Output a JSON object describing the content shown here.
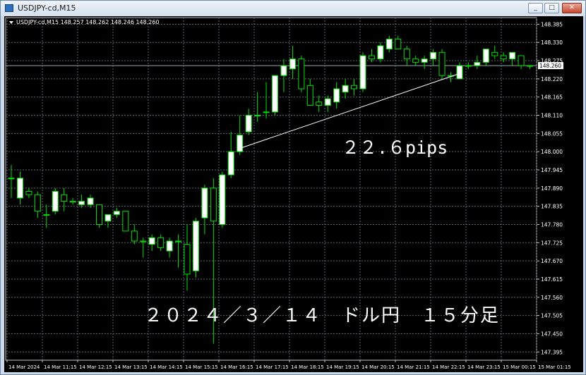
{
  "window": {
    "title": "USDJPY-cd,M15",
    "buttons": {
      "minimize": "_",
      "maximize": "□",
      "close": "✕"
    }
  },
  "chart": {
    "header": "USDJPY-cd,M15  148.257 148.262 148.246 148.260",
    "current_price_label": "148.260",
    "pips_annotation": "２２.６pips",
    "caption": "２０２４／３／１４　ドル円　１５分足",
    "colors": {
      "background": "#000000",
      "grid": "#5a6670",
      "bull_body": "#ffffff",
      "bear_body": "#000000",
      "candle_outline": "#00e000",
      "text": "#ffffff",
      "price_line": "#9aa4ad",
      "trend_line": "#ffffff"
    }
  },
  "chart_data": {
    "type": "candlestick",
    "symbol": "USDJPY-cd",
    "timeframe": "M15",
    "y_axis_ticks": [
      "148.385",
      "148.330",
      "148.275",
      "148.220",
      "148.165",
      "148.110",
      "148.055",
      "148.000",
      "147.945",
      "147.890",
      "147.835",
      "147.780",
      "147.725",
      "147.670",
      "147.615",
      "147.560",
      "147.505",
      "147.450",
      "147.395"
    ],
    "ylim": [
      147.37,
      148.405
    ],
    "x_axis_ticks": [
      "14 Mar 2024",
      "14 Mar 11:15",
      "14 Mar 12:15",
      "14 Mar 13:15",
      "14 Mar 14:15",
      "14 Mar 15:15",
      "14 Mar 16:15",
      "14 Mar 17:15",
      "14 Mar 18:15",
      "14 Mar 19:15",
      "14 Mar 20:15",
      "14 Mar 21:15",
      "14 Mar 22:15",
      "14 Mar 23:15",
      "15 Mar 00:15",
      "15 Mar 01:15"
    ],
    "current_price": 148.26,
    "trend_line": {
      "from": {
        "bar": 26,
        "price": 148.01
      },
      "to": {
        "bar": 51,
        "price": 148.236
      }
    },
    "candles": [
      {
        "o": 147.92,
        "h": 147.96,
        "l": 147.86,
        "c": 147.92
      },
      {
        "o": 147.86,
        "h": 147.94,
        "l": 147.84,
        "c": 147.92
      },
      {
        "o": 147.88,
        "h": 147.89,
        "l": 147.86,
        "c": 147.87
      },
      {
        "o": 147.87,
        "h": 147.88,
        "l": 147.8,
        "c": 147.82
      },
      {
        "o": 147.81,
        "h": 147.84,
        "l": 147.77,
        "c": 147.81
      },
      {
        "o": 147.82,
        "h": 147.89,
        "l": 147.81,
        "c": 147.88
      },
      {
        "o": 147.87,
        "h": 147.89,
        "l": 147.82,
        "c": 147.85
      },
      {
        "o": 147.85,
        "h": 147.86,
        "l": 147.84,
        "c": 147.85
      },
      {
        "o": 147.84,
        "h": 147.87,
        "l": 147.83,
        "c": 147.85
      },
      {
        "o": 147.84,
        "h": 147.87,
        "l": 147.83,
        "c": 147.86
      },
      {
        "o": 147.84,
        "h": 147.84,
        "l": 147.77,
        "c": 147.78
      },
      {
        "o": 147.79,
        "h": 147.81,
        "l": 147.77,
        "c": 147.81
      },
      {
        "o": 147.81,
        "h": 147.83,
        "l": 147.8,
        "c": 147.82
      },
      {
        "o": 147.82,
        "h": 147.82,
        "l": 147.76,
        "c": 147.76
      },
      {
        "o": 147.76,
        "h": 147.78,
        "l": 147.72,
        "c": 147.73
      },
      {
        "o": 147.73,
        "h": 147.74,
        "l": 147.68,
        "c": 147.73
      },
      {
        "o": 147.72,
        "h": 147.75,
        "l": 147.7,
        "c": 147.74
      },
      {
        "o": 147.74,
        "h": 147.75,
        "l": 147.7,
        "c": 147.71
      },
      {
        "o": 147.7,
        "h": 147.74,
        "l": 147.68,
        "c": 147.73
      },
      {
        "o": 147.73,
        "h": 147.75,
        "l": 147.65,
        "c": 147.73
      },
      {
        "o": 147.72,
        "h": 147.78,
        "l": 147.58,
        "c": 147.63
      },
      {
        "o": 147.64,
        "h": 147.8,
        "l": 147.62,
        "c": 147.79
      },
      {
        "o": 147.8,
        "h": 147.9,
        "l": 147.75,
        "c": 147.89
      },
      {
        "o": 147.89,
        "h": 147.92,
        "l": 147.42,
        "c": 147.79
      },
      {
        "o": 147.78,
        "h": 147.94,
        "l": 147.77,
        "c": 147.93
      },
      {
        "o": 147.93,
        "h": 148.06,
        "l": 147.92,
        "c": 148.0
      },
      {
        "o": 148.0,
        "h": 148.11,
        "l": 147.99,
        "c": 148.05
      },
      {
        "o": 148.06,
        "h": 148.13,
        "l": 148.05,
        "c": 148.11
      },
      {
        "o": 148.11,
        "h": 148.18,
        "l": 148.09,
        "c": 148.11
      },
      {
        "o": 148.12,
        "h": 148.21,
        "l": 148.1,
        "c": 148.12
      },
      {
        "o": 148.12,
        "h": 148.18,
        "l": 148.11,
        "c": 148.23
      },
      {
        "o": 148.23,
        "h": 148.28,
        "l": 148.18,
        "c": 148.26
      },
      {
        "o": 148.25,
        "h": 148.32,
        "l": 148.22,
        "c": 148.28
      },
      {
        "o": 148.28,
        "h": 148.29,
        "l": 148.18,
        "c": 148.19
      },
      {
        "o": 148.2,
        "h": 148.22,
        "l": 148.14,
        "c": 148.14
      },
      {
        "o": 148.15,
        "h": 148.17,
        "l": 148.12,
        "c": 148.14
      },
      {
        "o": 148.14,
        "h": 148.17,
        "l": 148.12,
        "c": 148.16
      },
      {
        "o": 148.15,
        "h": 148.21,
        "l": 148.13,
        "c": 148.19
      },
      {
        "o": 148.18,
        "h": 148.22,
        "l": 148.16,
        "c": 148.2
      },
      {
        "o": 148.2,
        "h": 148.22,
        "l": 148.17,
        "c": 148.19
      },
      {
        "o": 148.19,
        "h": 148.3,
        "l": 148.18,
        "c": 148.29
      },
      {
        "o": 148.29,
        "h": 148.31,
        "l": 148.27,
        "c": 148.28
      },
      {
        "o": 148.28,
        "h": 148.33,
        "l": 148.27,
        "c": 148.32
      },
      {
        "o": 148.31,
        "h": 148.35,
        "l": 148.3,
        "c": 148.34
      },
      {
        "o": 148.34,
        "h": 148.35,
        "l": 148.31,
        "c": 148.31
      },
      {
        "o": 148.31,
        "h": 148.32,
        "l": 148.26,
        "c": 148.28
      },
      {
        "o": 148.28,
        "h": 148.29,
        "l": 148.26,
        "c": 148.27
      },
      {
        "o": 148.27,
        "h": 148.29,
        "l": 148.25,
        "c": 148.28
      },
      {
        "o": 148.28,
        "h": 148.31,
        "l": 148.26,
        "c": 148.3
      },
      {
        "o": 148.3,
        "h": 148.31,
        "l": 148.22,
        "c": 148.23
      },
      {
        "o": 148.23,
        "h": 148.24,
        "l": 148.21,
        "c": 148.23
      },
      {
        "o": 148.22,
        "h": 148.27,
        "l": 148.22,
        "c": 148.26
      },
      {
        "o": 148.26,
        "h": 148.27,
        "l": 148.25,
        "c": 148.26
      },
      {
        "o": 148.26,
        "h": 148.29,
        "l": 148.25,
        "c": 148.27
      },
      {
        "o": 148.27,
        "h": 148.31,
        "l": 148.26,
        "c": 148.31
      },
      {
        "o": 148.3,
        "h": 148.32,
        "l": 148.28,
        "c": 148.29
      },
      {
        "o": 148.29,
        "h": 148.3,
        "l": 148.27,
        "c": 148.28
      },
      {
        "o": 148.28,
        "h": 148.3,
        "l": 148.26,
        "c": 148.3
      },
      {
        "o": 148.29,
        "h": 148.29,
        "l": 148.25,
        "c": 148.26
      },
      {
        "o": 148.26,
        "h": 148.26,
        "l": 148.25,
        "c": 148.26
      }
    ]
  }
}
